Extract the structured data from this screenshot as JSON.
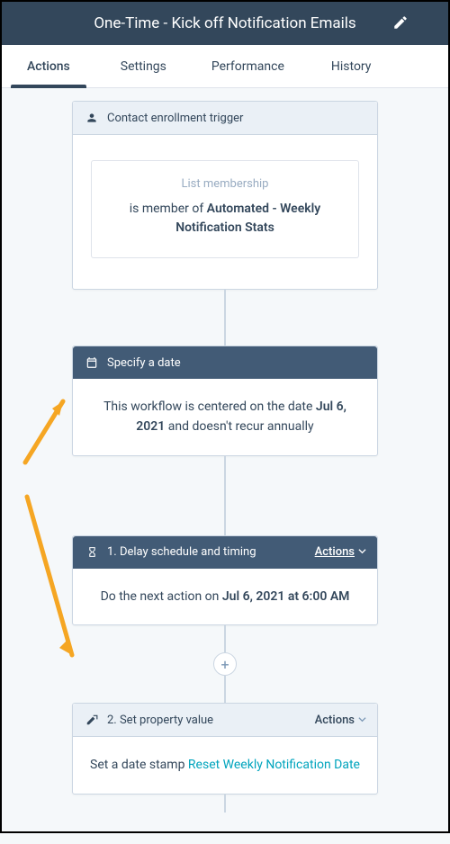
{
  "header": {
    "title": "One-Time - Kick off Notification Emails"
  },
  "tabs": [
    "Actions",
    "Settings",
    "Performance",
    "History"
  ],
  "activeTab": 0,
  "trigger": {
    "title": "Contact enrollment trigger",
    "boxLabel": "List membership",
    "prefix": "is member of ",
    "listName": "Automated - Weekly Notification Stats"
  },
  "specifyDate": {
    "title": "Specify a date",
    "textPrefix": "This workflow is centered on the date ",
    "date": "Jul 6, 2021",
    "textSuffix": " and doesn't recur annually"
  },
  "delay": {
    "title": "1. Delay schedule and timing",
    "actionsLabel": "Actions",
    "textPrefix": "Do the next action on ",
    "dateTime": "Jul 6, 2021 at 6:00 AM"
  },
  "setProp": {
    "title": "2. Set property value",
    "actionsLabel": "Actions",
    "textPrefix": "Set a date stamp ",
    "propName": "Reset Weekly Notification Date"
  },
  "plus": "+"
}
